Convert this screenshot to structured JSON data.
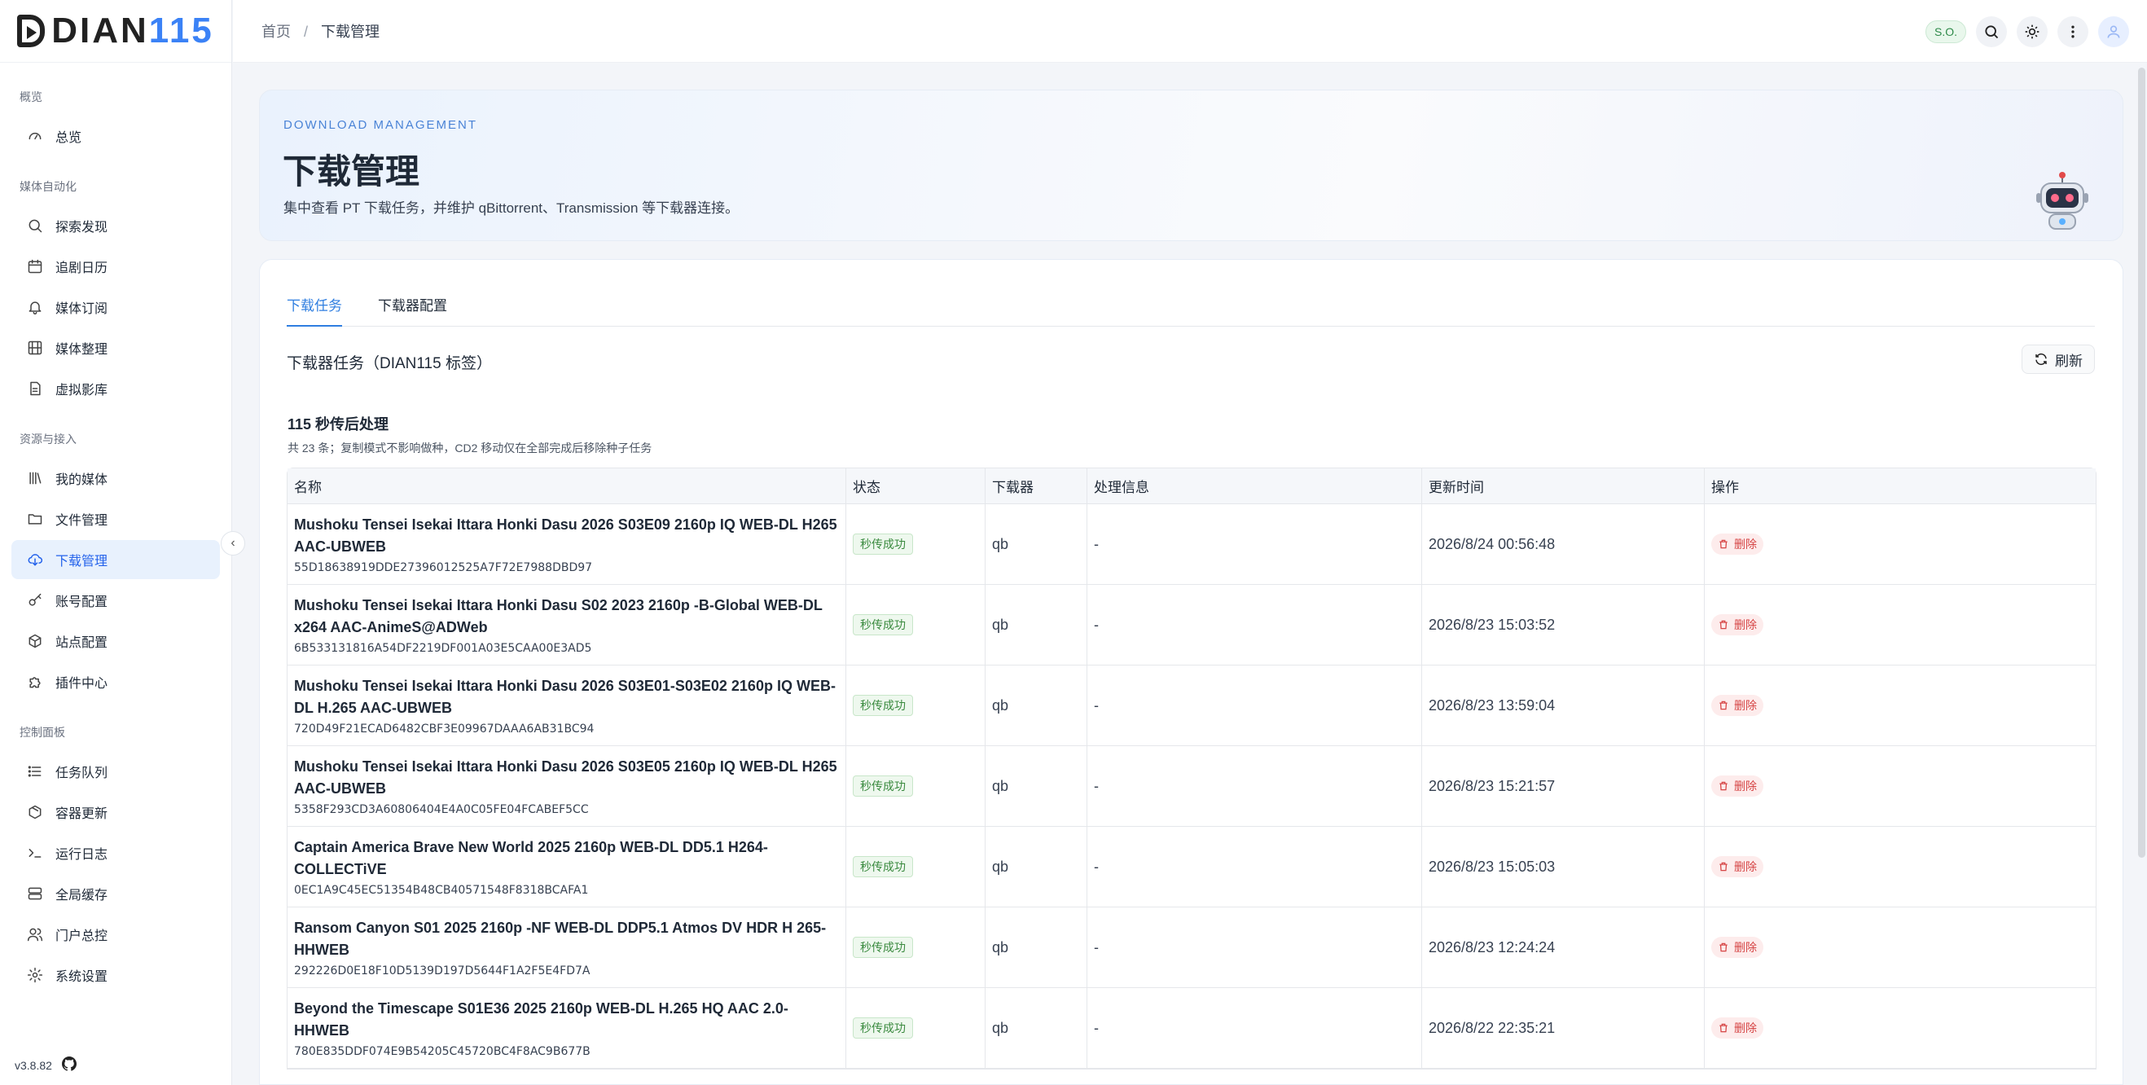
{
  "app": {
    "logo_prefix": "DIAN",
    "logo_number": "115",
    "version": "v3.8.82"
  },
  "sidebar": {
    "groups": [
      {
        "title": "概览",
        "items": [
          {
            "label": "总览",
            "icon": "gauge-icon"
          }
        ]
      },
      {
        "title": "媒体自动化",
        "items": [
          {
            "label": "探索发现",
            "icon": "search-icon"
          },
          {
            "label": "追剧日历",
            "icon": "calendar-icon"
          },
          {
            "label": "媒体订阅",
            "icon": "bell-icon"
          },
          {
            "label": "媒体整理",
            "icon": "film-icon"
          },
          {
            "label": "虚拟影库",
            "icon": "file-icon"
          }
        ]
      },
      {
        "title": "资源与接入",
        "items": [
          {
            "label": "我的媒体",
            "icon": "library-icon"
          },
          {
            "label": "文件管理",
            "icon": "folder-icon"
          },
          {
            "label": "下载管理",
            "icon": "cloud-download-icon",
            "active": true
          },
          {
            "label": "账号配置",
            "icon": "key-icon"
          },
          {
            "label": "站点配置",
            "icon": "cube-icon"
          },
          {
            "label": "插件中心",
            "icon": "puzzle-icon"
          }
        ]
      },
      {
        "title": "控制面板",
        "items": [
          {
            "label": "任务队列",
            "icon": "list-icon"
          },
          {
            "label": "容器更新",
            "icon": "package-icon"
          },
          {
            "label": "运行日志",
            "icon": "terminal-icon"
          },
          {
            "label": "全局缓存",
            "icon": "server-icon"
          },
          {
            "label": "门户总控",
            "icon": "users-icon"
          },
          {
            "label": "系统设置",
            "icon": "gear-icon"
          }
        ]
      }
    ]
  },
  "topbar": {
    "breadcrumb": {
      "home": "首页",
      "separator": "/",
      "current": "下载管理"
    },
    "user_badge": "S.O."
  },
  "hero": {
    "kicker": "DOWNLOAD MANAGEMENT",
    "title": "下载管理",
    "description": "集中查看 PT 下载任务，并维护 qBittorrent、Transmission 等下载器连接。"
  },
  "tabs": [
    {
      "label": "下载任务",
      "active": true
    },
    {
      "label": "下载器配置",
      "active": false
    }
  ],
  "tasks_section": {
    "title": "下载器任务（DIAN115 标签）",
    "refresh_label": "刷新",
    "subsection_title": "115 秒传后处理",
    "subsection_desc": "共 23 条；复制模式不影响做种，CD2 移动仅在全部完成后移除种子任务"
  },
  "table": {
    "columns": [
      "名称",
      "状态",
      "下载器",
      "处理信息",
      "更新时间",
      "操作"
    ],
    "rows": [
      {
        "name": "Mushoku Tensei Isekai Ittara Honki Dasu 2026 S03E09 2160p IQ WEB-DL H265 AAC-UBWEB",
        "hash": "55D18638919DDE27396012525A7F72E7988DBD97",
        "status": "秒传成功",
        "downloader": "qb",
        "info": "-",
        "updated": "2026/8/24 00:56:48",
        "action": "删除"
      },
      {
        "name": "Mushoku Tensei Isekai Ittara Honki Dasu S02 2023 2160p -B-Global WEB-DL x264 AAC-AnimeS@ADWeb",
        "hash": "6B533131816A54DF2219DF001A03E5CAA00E3AD5",
        "status": "秒传成功",
        "downloader": "qb",
        "info": "-",
        "updated": "2026/8/23 15:03:52",
        "action": "删除"
      },
      {
        "name": "Mushoku Tensei Isekai Ittara Honki Dasu 2026 S03E01-S03E02 2160p IQ WEB-DL H.265 AAC-UBWEB",
        "hash": "720D49F21ECAD6482CBF3E09967DAAA6AB31BC94",
        "status": "秒传成功",
        "downloader": "qb",
        "info": "-",
        "updated": "2026/8/23 13:59:04",
        "action": "删除"
      },
      {
        "name": "Mushoku Tensei Isekai Ittara Honki Dasu 2026 S03E05 2160p IQ WEB-DL H265 AAC-UBWEB",
        "hash": "5358F293CD3A60806404E4A0C05FE04FCABEF5CC",
        "status": "秒传成功",
        "downloader": "qb",
        "info": "-",
        "updated": "2026/8/23 15:21:57",
        "action": "删除"
      },
      {
        "name": "Captain America Brave New World 2025 2160p WEB-DL DD5.1 H264-COLLECTiVE",
        "hash": "0EC1A9C45EC51354B48CB40571548F8318BCAFA1",
        "status": "秒传成功",
        "downloader": "qb",
        "info": "-",
        "updated": "2026/8/23 15:05:03",
        "action": "删除"
      },
      {
        "name": "Ransom Canyon S01 2025 2160p -NF WEB-DL DDP5.1 Atmos DV HDR H 265-HHWEB",
        "hash": "292226D0E18F10D5139D197D5644F1A2F5E4FD7A",
        "status": "秒传成功",
        "downloader": "qb",
        "info": "-",
        "updated": "2026/8/23 12:24:24",
        "action": "删除"
      },
      {
        "name": "Beyond the Timescape S01E36 2025 2160p WEB-DL H.265 HQ AAC 2.0-HHWEB",
        "hash": "780E835DDF074E9B54205C45720BC4F8AC9B677B",
        "status": "秒传成功",
        "downloader": "qb",
        "info": "-",
        "updated": "2026/8/22 22:35:21",
        "action": "删除"
      }
    ]
  }
}
